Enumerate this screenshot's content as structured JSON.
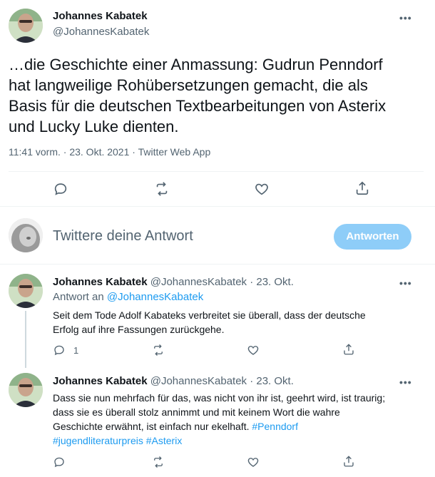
{
  "main_tweet": {
    "author_name": "Johannes Kabatek",
    "handle": "@JohannesKabatek",
    "more_label": "•••",
    "text_lines": [
      "…die Geschichte einer Anmassung: Gudrun Penndorf",
      "hat langweilige Rohübersetzungen gemacht, die als",
      "Basis für die deutschen Textbearbeitungen von Asterix",
      "und Lucky Luke dienten."
    ],
    "meta": "11:41 vorm. · 23. Okt. 2021 · Twitter Web App",
    "actions": [
      "reply-icon",
      "retweet-icon",
      "like-icon",
      "share-icon"
    ]
  },
  "compose": {
    "placeholder": "Twittere deine Antwort",
    "button_label": "Antworten",
    "button_color": "#8ecdf8"
  },
  "replies": [
    {
      "author_name": "Johannes Kabatek",
      "handle_time": "@JohannesKabatek · 23. Okt.",
      "reply_to_prefix": "Antwort an",
      "reply_to_handle": "@JohannesKabatek",
      "text_lines": [
        "Seit dem Tode Adolf Kabateks verbreitet sie überall, dass der deutsche",
        "Erfolg auf ihre Fassungen zurückgehe."
      ],
      "reply_count": "1",
      "more_label": "•••"
    },
    {
      "author_name": "Johannes Kabatek",
      "handle_time": "@JohannesKabatek · 23. Okt.",
      "line1": "Dass sie nun mehrfach für das, was nicht von ihr ist, geehrt wird, ist traurig;",
      "line2": "dass sie es überall stolz annimmt und mit keinem Wort die wahre",
      "line3_text": "Geschichte erwähnt, ist einfach nur ekelhaft.",
      "line3_tag": "#Penndorf",
      "tags_line": [
        "#jugendliteraturpreis",
        "#Asterix"
      ],
      "more_label": "•••"
    }
  ],
  "colors": {
    "text": "#0f1419",
    "muted": "#536471",
    "link": "#1d9bf0",
    "divider": "#eff3f4"
  }
}
